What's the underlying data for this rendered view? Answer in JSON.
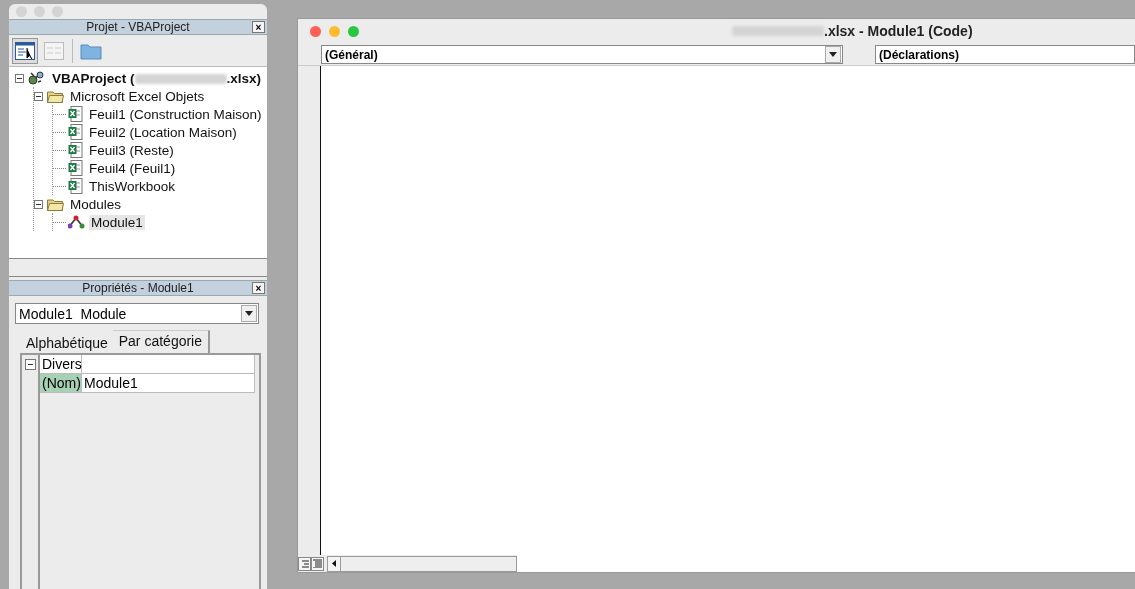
{
  "project_window": {
    "title": "Projet - VBAProject",
    "close_label": "×",
    "toolbar": [
      {
        "kind": "view-code",
        "selected": true
      },
      {
        "kind": "view-object",
        "selected": false
      },
      {
        "kind": "toggle-folders",
        "selected": false
      }
    ],
    "tree": [
      {
        "kind": "project",
        "label": "VBAProject (",
        "label_end": ".xlsx)",
        "redacted": true,
        "expanded": true,
        "selected": false,
        "children": [
          {
            "kind": "folder",
            "label": "Microsoft Excel Objets",
            "expanded": true,
            "selected": false,
            "children": [
              {
                "kind": "sheet",
                "label": "Feuil1 (Construction Maison)",
                "selected": false
              },
              {
                "kind": "sheet",
                "label": "Feuil2 (Location Maison)",
                "selected": false
              },
              {
                "kind": "sheet",
                "label": "Feuil3 (Reste)",
                "selected": false
              },
              {
                "kind": "sheet",
                "label": "Feuil4 (Feuil1)",
                "selected": false
              },
              {
                "kind": "sheet",
                "label": "ThisWorkbook",
                "selected": false
              }
            ]
          },
          {
            "kind": "folder",
            "label": "Modules",
            "expanded": true,
            "selected": false,
            "children": [
              {
                "kind": "module",
                "label": "Module1",
                "selected": true
              }
            ]
          }
        ]
      }
    ]
  },
  "properties_window": {
    "title": "Propriétés - Module1",
    "close_label": "×",
    "object": "Module1  Module",
    "tabs": [
      {
        "label": "Alphabétique",
        "selected": false
      },
      {
        "label": "Par catégorie",
        "selected": true
      }
    ],
    "groups": [
      {
        "label": "Divers",
        "expanded": true,
        "rows": [
          {
            "name": "(Nom)",
            "value": "Module1",
            "selected": true
          }
        ]
      }
    ]
  },
  "code_window": {
    "title": ".xlsx - Module1 (Code)",
    "redacted": true,
    "object_dropdown": "(Général)",
    "procedure_dropdown": "(Déclarations)"
  }
}
